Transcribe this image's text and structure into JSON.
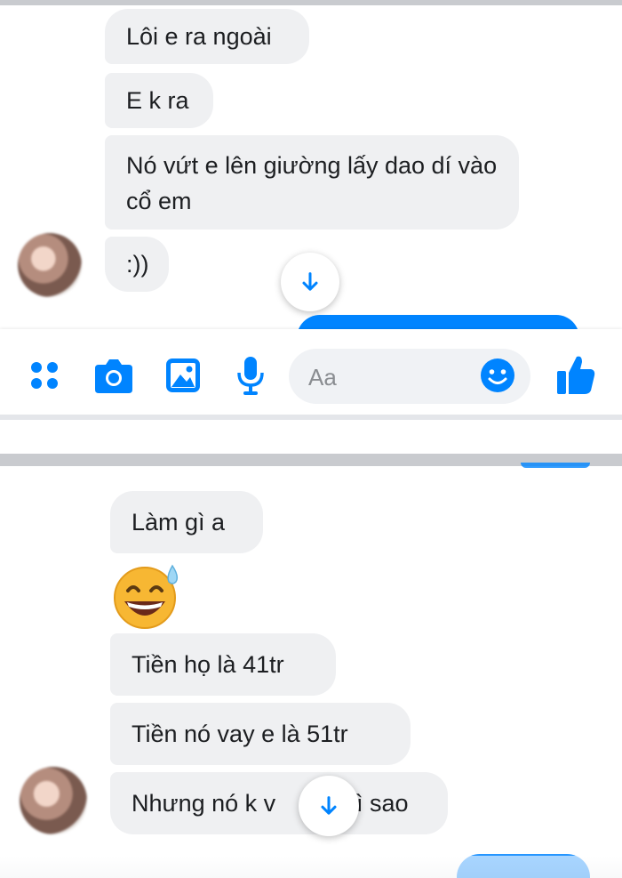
{
  "screenshot_top": {
    "messages": [
      "Lôi e ra ngoài",
      "E k ra",
      "Nó vứt e lên giường lấy dao dí vào cổ em",
      ":))"
    ]
  },
  "composer": {
    "placeholder": "Aa",
    "icons": [
      "apps-icon",
      "camera-icon",
      "image-icon",
      "microphone-icon",
      "emoji-icon",
      "like-icon"
    ],
    "accent_color": "#0084ff"
  },
  "screenshot_bottom": {
    "messages": [
      "Làm gì a",
      "Tiền họ là 41tr",
      "Tiền nó vay e là 51tr",
      "Nhưng nó k v",
      "hì sao"
    ],
    "emoji": "sweat-smile-emoji"
  }
}
